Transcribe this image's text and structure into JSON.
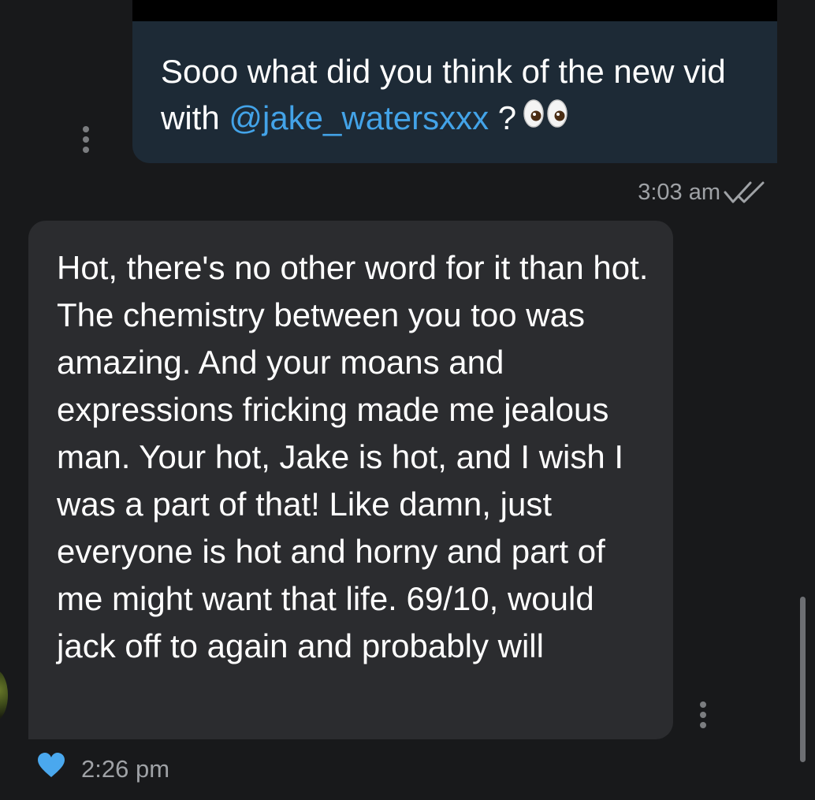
{
  "sent_message": {
    "text_before_mention": "Sooo what did you think of the new vid with ",
    "mention": "@jake_watersxxx",
    "text_after_mention": " ?",
    "emoji": "eyes-emoji",
    "time": "3:03 am",
    "status_icon": "double-check-icon"
  },
  "received_message": {
    "text": "Hot, there's no other word for it than hot. The chemistry between you too was amazing. And your moans and expressions fricking made me jealous man. Your hot, Jake is hot, and I wish I was a part of that! Like damn, just everyone is hot and horny and part of me might want that life. 69/10, would jack off to again and probably will",
    "time": "2:26 pm",
    "reaction_icon": "heart-icon"
  },
  "colors": {
    "background": "#18191b",
    "sent_bubble": "#1d2a36",
    "received_bubble": "#2b2c2f",
    "mention": "#43a3e8",
    "heart": "#4aa8ee",
    "meta_text": "#9fa2a6"
  }
}
